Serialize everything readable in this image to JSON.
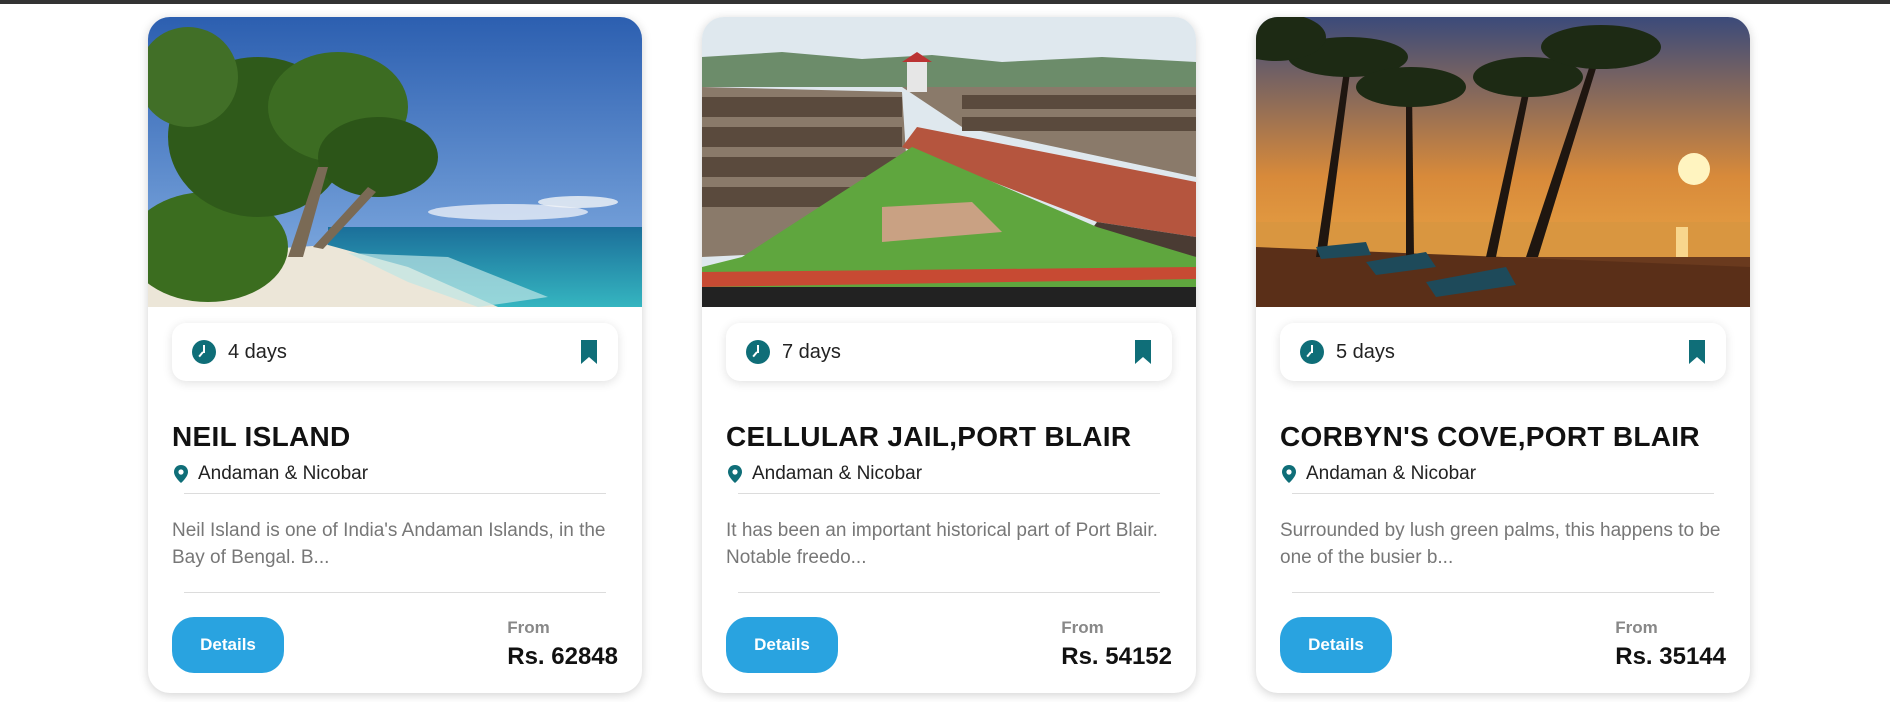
{
  "theme": {
    "accent": "#0f6e78",
    "button": "#29a3e0"
  },
  "cards": [
    {
      "image_alt": "Beach with trees and turquoise sea",
      "duration": "4 days",
      "title": "NEIL ISLAND",
      "location": "Andaman & Nicobar",
      "description": "Neil Island is one of India's Andaman Islands, in the Bay of Bengal. B...",
      "button_label": "Details",
      "price_prefix": "From",
      "price": "Rs. 62848"
    },
    {
      "image_alt": "Cellular Jail courtyard with garden",
      "duration": "7 days",
      "title": "CELLULAR JAIL,PORT BLAIR",
      "location": "Andaman & Nicobar",
      "description": "It has been an important historical part of Port Blair. Notable freedo...",
      "button_label": "Details",
      "price_prefix": "From",
      "price": "Rs. 54152"
    },
    {
      "image_alt": "Palm trees and loungers at sunset beach",
      "duration": "5 days",
      "title": "CORBYN'S COVE,PORT BLAIR",
      "location": "Andaman & Nicobar",
      "description": "Surrounded by lush green palms, this happens to be one of the busier b...",
      "button_label": "Details",
      "price_prefix": "From",
      "price": "Rs. 35144"
    }
  ]
}
